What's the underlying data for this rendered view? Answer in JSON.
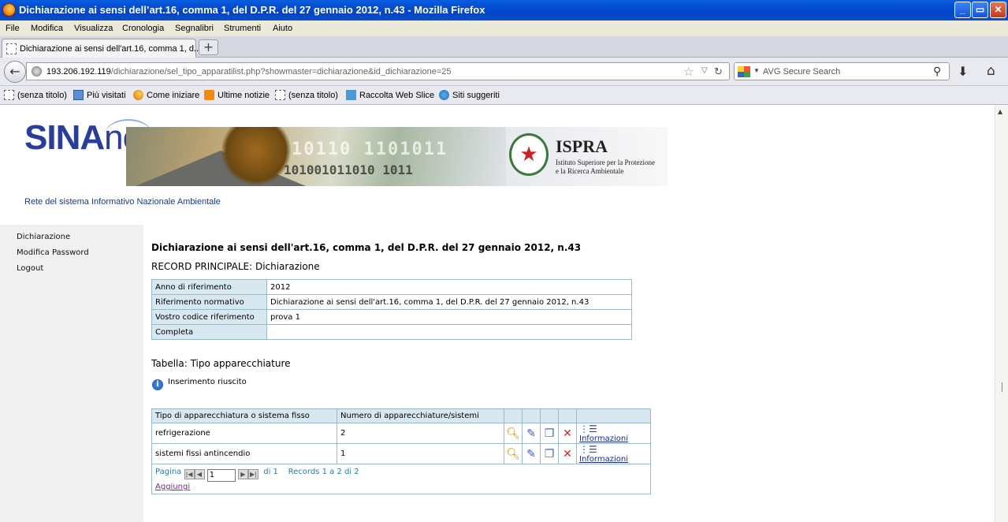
{
  "window": {
    "title": "Dichiarazione ai sensi dell’art.16, comma 1, del D.P.R. del 27 gennaio 2012, n.43 - Mozilla Firefox",
    "buttons": [
      "_",
      "▭",
      "✕"
    ]
  },
  "menu": [
    "File",
    "Modifica",
    "Visualizza",
    "Cronologia",
    "Segnalibri",
    "Strumenti",
    "Aiuto"
  ],
  "tab": {
    "label": "Dichiarazione ai sensi dell'art.16, comma 1, d...",
    "new_tab": "+"
  },
  "nav": {
    "url_host": "193.206.192.119",
    "url_path": "/dichiarazione/sel_tipo_apparatilist.php?showmaster=dichiarazione&id_dichiarazione=25",
    "search_placeholder": "AVG Secure Search"
  },
  "bookmarks": [
    "(senza titolo)",
    "Più visitati",
    "Come iniziare",
    "Ultime notizie",
    "(senza titolo)",
    "Raccolta Web Slice",
    "Siti suggeriti"
  ],
  "header": {
    "logo_text": "SINA",
    "logo_suffix": "net",
    "ispra_title": "ISPRA",
    "ispra_sub1": "Istituto Superiore per la Protezione",
    "ispra_sub2": "e la Ricerca Ambientale",
    "tagline": "Rete del sistema Informativo Nazionale Ambientale"
  },
  "sidebar": [
    "Dichiarazione",
    "Modifica Password",
    "Logout"
  ],
  "main": {
    "title": "Dichiarazione ai sensi dell'art.16, comma 1, del D.P.R. del 27 gennaio 2012, n.43",
    "record_heading": "RECORD PRINCIPALE: Dichiarazione",
    "record": [
      {
        "key": "Anno di riferimento",
        "value": "2012"
      },
      {
        "key": "Riferimento normativo",
        "value": "Dichiarazione ai sensi dell'art.16, comma 1, del D.P.R. del 27 gennaio 2012, n.43"
      },
      {
        "key": "Vostro codice riferimento",
        "value": "prova 1"
      },
      {
        "key": "Completa",
        "value": ""
      }
    ],
    "table_heading": "Tabella: Tipo apparecchiature",
    "info_message": "Inserimento riuscito",
    "columns": [
      "Tipo di apparecchiatura o sistema fisso",
      "Numero di apparecchiature/sistemi"
    ],
    "rows": [
      {
        "tipo": "refrigerazione",
        "numero": "2",
        "link": "Informazioni"
      },
      {
        "tipo": "sistemi fissi antincendio",
        "numero": "1",
        "link": "Informazioni"
      }
    ],
    "pager": {
      "label": "Pagina",
      "page_value": "1",
      "of": "di 1",
      "records": "Records 1 a 2 di 2"
    },
    "add_link": "Aggiungi"
  }
}
